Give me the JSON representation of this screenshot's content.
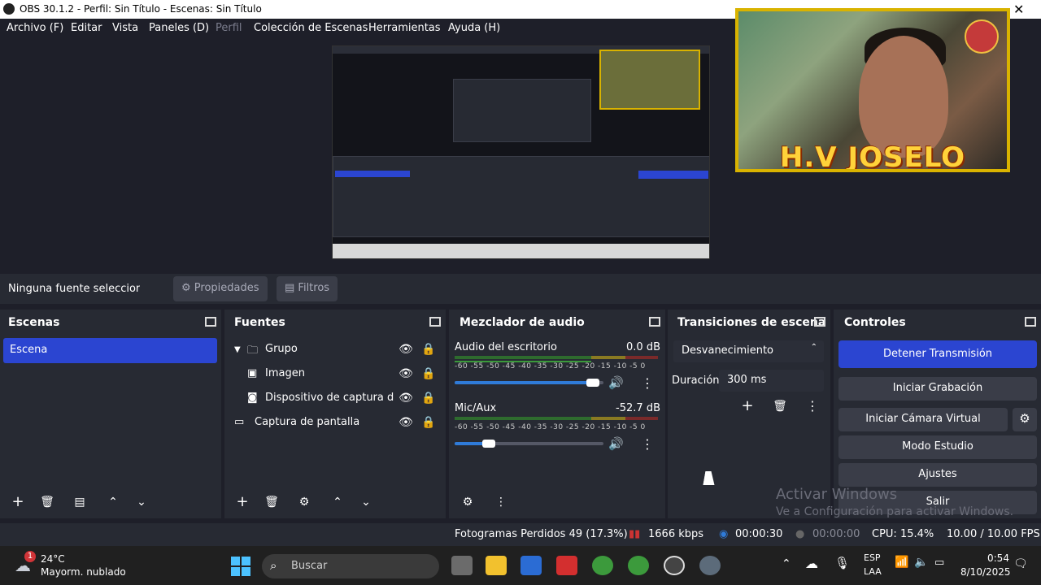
{
  "window": {
    "title": "OBS 30.1.2 - Perfil: Sin Título - Escenas: Sin Título",
    "close": "✕"
  },
  "menu": [
    "Archivo (F)",
    "Editar",
    "Vista",
    "Paneles (D)",
    "Perfil",
    "Colección de Escenas",
    "Herramientas",
    "Ayuda (H)"
  ],
  "webcam": {
    "overlay_text": "H.V JOSELO"
  },
  "source_bar": {
    "label": "Ninguna fuente seleccionad",
    "properties": "Propiedades",
    "filters": "Filtros"
  },
  "docks": {
    "scenes": {
      "title": "Escenas",
      "items": [
        "Escena"
      ]
    },
    "sources": {
      "title": "Fuentes",
      "items": [
        "Grupo",
        "Imagen",
        "Dispositivo de captura de v",
        "Captura de pantalla"
      ]
    },
    "mixer": {
      "title": "Mezclador de audio",
      "channels": [
        {
          "name": "Audio del escritorio",
          "db": "0.0 dB",
          "volume": 0.93
        },
        {
          "name": "Mic/Aux",
          "db": "-52.7 dB",
          "volume": 0.23
        }
      ],
      "scale": "-60 -55 -50 -45 -40 -35 -30 -25 -20 -15 -10 -5 0"
    },
    "transitions": {
      "title": "Transiciones de escena",
      "transition": "Desvanecimiento",
      "duration_label": "Duración",
      "duration": "300 ms"
    },
    "controls": {
      "title": "Controles",
      "stop_stream": "Detener Transmisión",
      "start_recording": "Iniciar Grabación",
      "start_virtual_cam": "Iniciar Cámara Virtual",
      "studio_mode": "Modo Estudio",
      "settings": "Ajustes",
      "exit": "Salir"
    }
  },
  "watermark": {
    "line1": "Activar Windows",
    "line2": "Ve a Configuración para activar Windows."
  },
  "status": {
    "dropped": "Fotogramas Perdidos 49 (17.3%)",
    "bitrate": "1666 kbps",
    "stream_time": "00:00:30",
    "rec_time": "00:00:00",
    "cpu": "CPU: 15.4%",
    "fps": "10.00 / 10.00 FPS"
  },
  "taskbar": {
    "weather_temp": "24°C",
    "weather_desc": "Mayorm. nublado",
    "weather_badge": "1",
    "search_placeholder": "Buscar",
    "lang1": "ESP",
    "lang2": "LAA",
    "time": "0:54",
    "date": "8/10/2025"
  }
}
